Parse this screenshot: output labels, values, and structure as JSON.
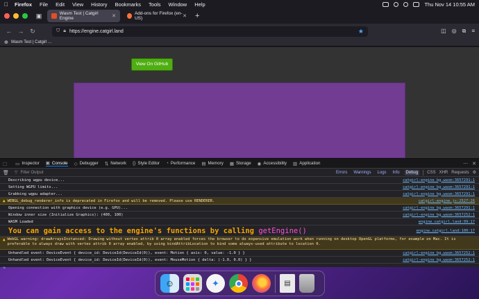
{
  "menubar": {
    "apple": "",
    "app_name": "Firefox",
    "items": [
      "File",
      "Edit",
      "View",
      "History",
      "Bookmarks",
      "Tools",
      "Window",
      "Help"
    ],
    "datetime": "Thu Nov 14  10:55 AM"
  },
  "browser": {
    "tabs": [
      {
        "title": "Wasm Test | Catgirl Engine",
        "active": true,
        "favicon_color": "#e44d26"
      },
      {
        "title": "Add-ons for Firefox (en-US)",
        "active": false,
        "favicon_color": "#ff7139"
      }
    ],
    "url": "https://engine.catgirl.land",
    "bookmark": "Wasm Test | Catgirl ...",
    "nav_icons": {
      "back": "back-arrow-icon",
      "forward": "forward-arrow-icon",
      "reload": "reload-icon"
    }
  },
  "page": {
    "github_button": "View On GitHub",
    "canvas_color": "#713c92"
  },
  "devtools": {
    "tabs": [
      {
        "label": "Inspector",
        "icon": "inspector-icon",
        "active": false
      },
      {
        "label": "Console",
        "icon": "console-icon",
        "active": true
      },
      {
        "label": "Debugger",
        "icon": "debugger-icon",
        "active": false
      },
      {
        "label": "Network",
        "icon": "network-icon",
        "active": false
      },
      {
        "label": "Style Editor",
        "icon": "style-editor-icon",
        "active": false
      },
      {
        "label": "Performance",
        "icon": "performance-icon",
        "active": false
      },
      {
        "label": "Memory",
        "icon": "memory-icon",
        "active": false
      },
      {
        "label": "Storage",
        "icon": "storage-icon",
        "active": false
      },
      {
        "label": "Accessibility",
        "icon": "accessibility-icon",
        "active": false
      },
      {
        "label": "Application",
        "icon": "application-icon",
        "active": false
      }
    ],
    "filter_placeholder": "Filter Output",
    "levels": [
      {
        "label": "Errors",
        "on": false
      },
      {
        "label": "Warnings",
        "on": false
      },
      {
        "label": "Logs",
        "on": false
      },
      {
        "label": "Info",
        "on": false
      },
      {
        "label": "Debug",
        "on": true
      }
    ],
    "extra_filters": [
      "CSS",
      "XHR",
      "Requests"
    ],
    "log": [
      {
        "type": "log",
        "text": "Describing wgpu device...",
        "src": "catgirl-engine_bg.wasm:3657291:1"
      },
      {
        "type": "log",
        "text": "Setting WGPU limits...",
        "src": "catgirl-engine_bg.wasm:3657291:1"
      },
      {
        "type": "log",
        "text": "Grabbing wgpu adapter...",
        "src": "catgirl-engine_bg.wasm:3657291:1"
      },
      {
        "type": "warn",
        "text": "WEBGL_debug_renderer_info is deprecated in Firefox and will be removed. Please use RENDERER.",
        "src": "catgirl-engine.js:2527:26"
      },
      {
        "type": "log",
        "text": "Opening connection with graphics device (e.g. GPU)...",
        "src": "catgirl-engine_bg.wasm:3657291:1"
      },
      {
        "type": "log",
        "text": "Window inner size (Initialize Graphics): (400, 100)",
        "src": "catgirl-engine_bg.wasm:3657252:1"
      },
      {
        "type": "log",
        "text": "WASM Loaded",
        "src": "engine.catgirl.land:99:17"
      }
    ],
    "banner": {
      "text": "You can gain access to the engine's functions by calling ",
      "fn": "getEngine()",
      "src": "engine.catgirl.land:100:17"
    },
    "warning_long": {
      "text": "WebGL warning: drawArraysInstanced: Drawing without vertex attrib 0 array enabled forces the browser to do expensive emulation work when running on desktop OpenGL platforms, for example on Mac. It is preferable to always draw with vertex attrib 0 array enabled, by using bindAttribLocation to bind some always-used attribute to location 0."
    },
    "log_tail": [
      {
        "type": "log",
        "text": "Unhandled event: DeviceEvent { device_id: DeviceId(DeviceId(0)), event: Motion { axis: 0, value: -1.0 } }",
        "src": "catgirl-engine_bg.wasm:3657252:1"
      },
      {
        "type": "log",
        "text": "Unhandled event: DeviceEvent { device_id: DeviceId(DeviceId(0)), event: MouseMotion { delta: (-1.0, 0.0) } }",
        "src": "catgirl-engine_bg.wasm:3657252:1"
      }
    ],
    "prompt": "»"
  },
  "dock": {
    "apps": [
      "finder-icon",
      "launchpad-icon",
      "safari-icon",
      "chrome-icon",
      "firefox-icon",
      "document-icon",
      "trash-icon"
    ]
  }
}
